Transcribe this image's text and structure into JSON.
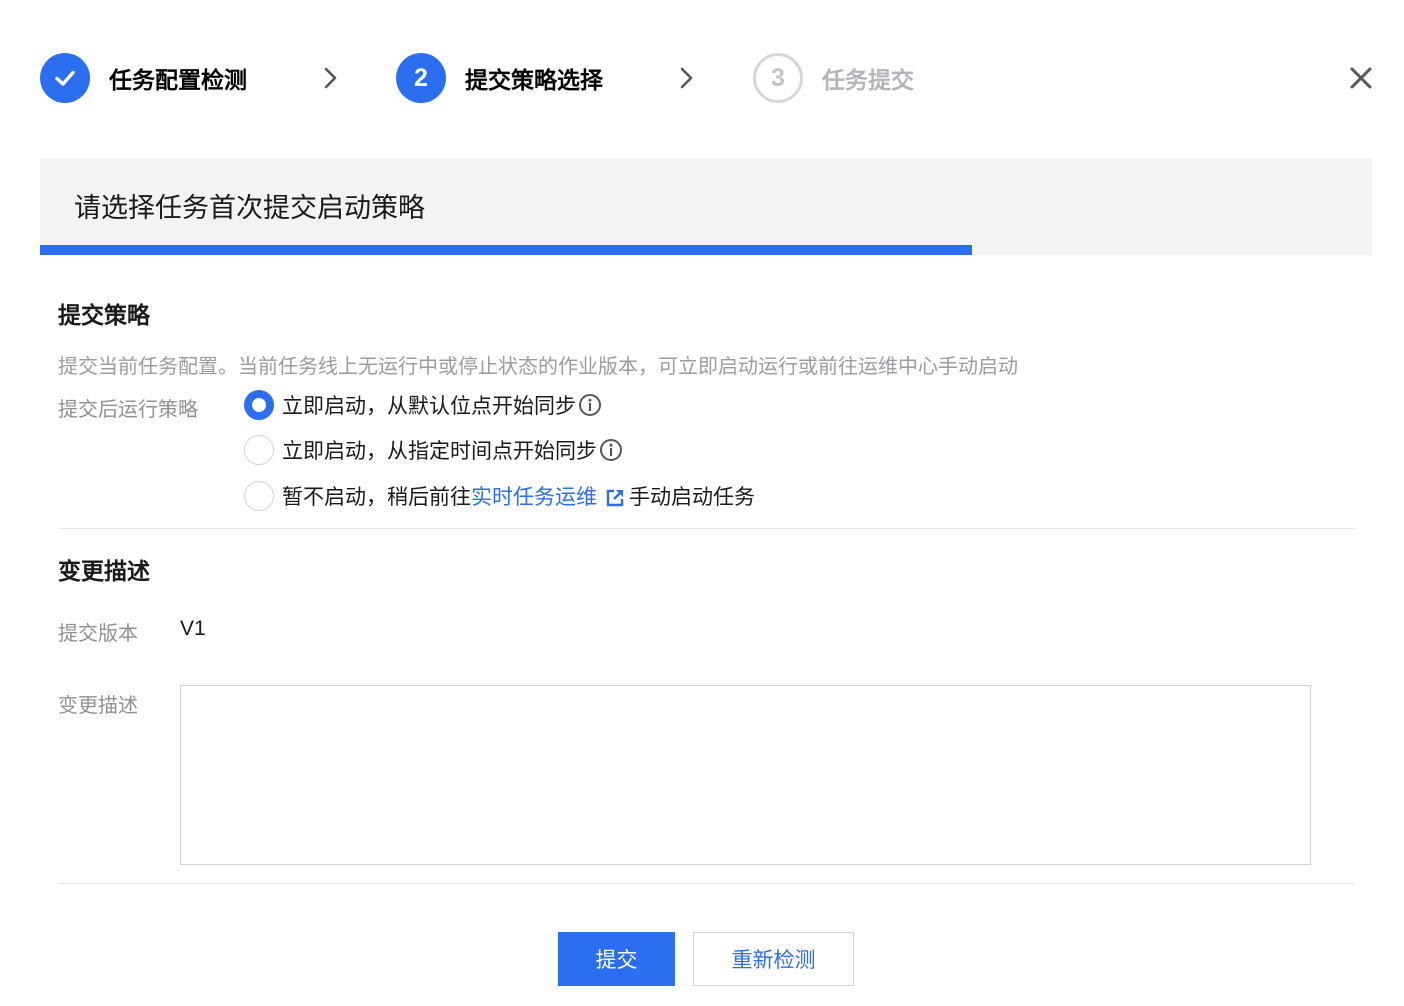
{
  "steps": [
    {
      "label": "任务配置检测",
      "state": "done"
    },
    {
      "number": "2",
      "label": "提交策略选择",
      "state": "active"
    },
    {
      "number": "3",
      "label": "任务提交",
      "state": "todo"
    }
  ],
  "banner": {
    "text": "请选择任务首次提交启动策略",
    "progress_percent": 70
  },
  "strategy": {
    "title": "提交策略",
    "description": "提交当前任务配置。当前任务线上无运行中或停止状态的作业版本，可立即启动运行或前往运维中心手动启动",
    "field_label": "提交后运行策略",
    "options": [
      {
        "label": "立即启动，从默认位点开始同步",
        "checked": true,
        "has_info": true
      },
      {
        "label": "立即启动，从指定时间点开始同步",
        "checked": false,
        "has_info": true
      },
      {
        "label_prefix": "暂不启动，稍后前往",
        "link": "实时任务运维",
        "label_suffix": "手动启动任务",
        "checked": false
      }
    ]
  },
  "change": {
    "title": "变更描述",
    "version_label": "提交版本",
    "version_value": "V1",
    "desc_label": "变更描述",
    "desc_value": "",
    "desc_placeholder": ""
  },
  "buttons": {
    "submit": "提交",
    "recheck": "重新检测"
  },
  "colors": {
    "accent": "#2b6ef0",
    "banner_bg": "#f2f3f5",
    "muted_text": "#9a9ca1"
  }
}
